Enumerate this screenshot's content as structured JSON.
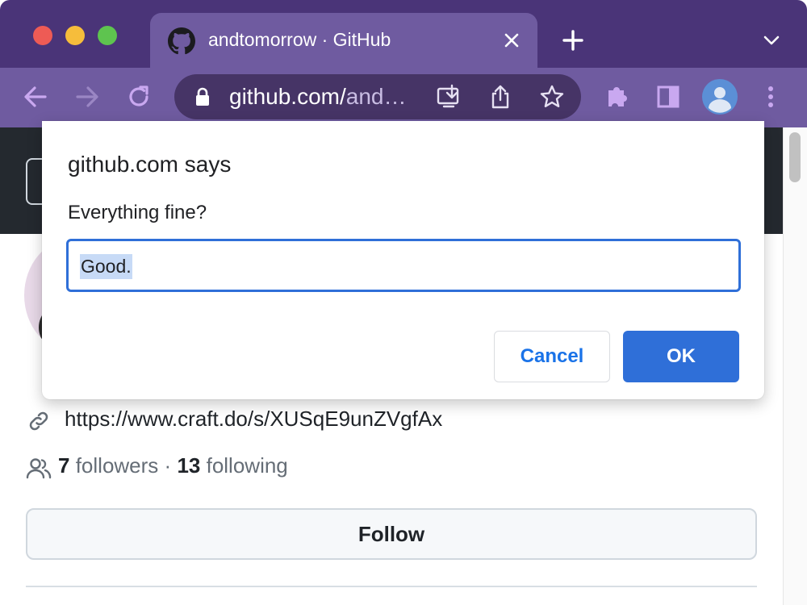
{
  "browser": {
    "tab": {
      "title": "andtomorrow · GitHub",
      "icon": "github-icon"
    },
    "address_bar": {
      "host": "github.com/",
      "path_truncated": "and…",
      "icon": "lock-icon"
    },
    "colors": {
      "titlebar": "#4a3478",
      "toolbar": "#6f5ba0",
      "omnibox": "#463466",
      "icon_tint": "#c9a8f0"
    }
  },
  "dialog": {
    "title": "github.com says",
    "message": "Everything fine?",
    "input_value": "Good.",
    "cancel_label": "Cancel",
    "ok_label": "OK",
    "accent": "#2f6fd8"
  },
  "profile": {
    "link": "https://www.craft.do/s/XUSqE9unZVgfAx",
    "followers_count": "7",
    "followers_label": "followers",
    "separator": "·",
    "following_count": "13",
    "following_label": "following",
    "follow_button": "Follow"
  }
}
